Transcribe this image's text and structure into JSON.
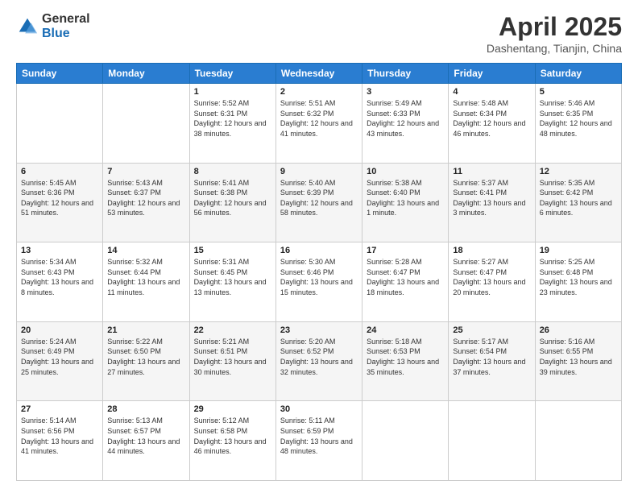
{
  "logo": {
    "general": "General",
    "blue": "Blue"
  },
  "title": "April 2025",
  "subtitle": "Dashentang, Tianjin, China",
  "days_of_week": [
    "Sunday",
    "Monday",
    "Tuesday",
    "Wednesday",
    "Thursday",
    "Friday",
    "Saturday"
  ],
  "weeks": [
    [
      {
        "day": "",
        "info": ""
      },
      {
        "day": "",
        "info": ""
      },
      {
        "day": "1",
        "info": "Sunrise: 5:52 AM\nSunset: 6:31 PM\nDaylight: 12 hours and 38 minutes."
      },
      {
        "day": "2",
        "info": "Sunrise: 5:51 AM\nSunset: 6:32 PM\nDaylight: 12 hours and 41 minutes."
      },
      {
        "day": "3",
        "info": "Sunrise: 5:49 AM\nSunset: 6:33 PM\nDaylight: 12 hours and 43 minutes."
      },
      {
        "day": "4",
        "info": "Sunrise: 5:48 AM\nSunset: 6:34 PM\nDaylight: 12 hours and 46 minutes."
      },
      {
        "day": "5",
        "info": "Sunrise: 5:46 AM\nSunset: 6:35 PM\nDaylight: 12 hours and 48 minutes."
      }
    ],
    [
      {
        "day": "6",
        "info": "Sunrise: 5:45 AM\nSunset: 6:36 PM\nDaylight: 12 hours and 51 minutes."
      },
      {
        "day": "7",
        "info": "Sunrise: 5:43 AM\nSunset: 6:37 PM\nDaylight: 12 hours and 53 minutes."
      },
      {
        "day": "8",
        "info": "Sunrise: 5:41 AM\nSunset: 6:38 PM\nDaylight: 12 hours and 56 minutes."
      },
      {
        "day": "9",
        "info": "Sunrise: 5:40 AM\nSunset: 6:39 PM\nDaylight: 12 hours and 58 minutes."
      },
      {
        "day": "10",
        "info": "Sunrise: 5:38 AM\nSunset: 6:40 PM\nDaylight: 13 hours and 1 minute."
      },
      {
        "day": "11",
        "info": "Sunrise: 5:37 AM\nSunset: 6:41 PM\nDaylight: 13 hours and 3 minutes."
      },
      {
        "day": "12",
        "info": "Sunrise: 5:35 AM\nSunset: 6:42 PM\nDaylight: 13 hours and 6 minutes."
      }
    ],
    [
      {
        "day": "13",
        "info": "Sunrise: 5:34 AM\nSunset: 6:43 PM\nDaylight: 13 hours and 8 minutes."
      },
      {
        "day": "14",
        "info": "Sunrise: 5:32 AM\nSunset: 6:44 PM\nDaylight: 13 hours and 11 minutes."
      },
      {
        "day": "15",
        "info": "Sunrise: 5:31 AM\nSunset: 6:45 PM\nDaylight: 13 hours and 13 minutes."
      },
      {
        "day": "16",
        "info": "Sunrise: 5:30 AM\nSunset: 6:46 PM\nDaylight: 13 hours and 15 minutes."
      },
      {
        "day": "17",
        "info": "Sunrise: 5:28 AM\nSunset: 6:47 PM\nDaylight: 13 hours and 18 minutes."
      },
      {
        "day": "18",
        "info": "Sunrise: 5:27 AM\nSunset: 6:47 PM\nDaylight: 13 hours and 20 minutes."
      },
      {
        "day": "19",
        "info": "Sunrise: 5:25 AM\nSunset: 6:48 PM\nDaylight: 13 hours and 23 minutes."
      }
    ],
    [
      {
        "day": "20",
        "info": "Sunrise: 5:24 AM\nSunset: 6:49 PM\nDaylight: 13 hours and 25 minutes."
      },
      {
        "day": "21",
        "info": "Sunrise: 5:22 AM\nSunset: 6:50 PM\nDaylight: 13 hours and 27 minutes."
      },
      {
        "day": "22",
        "info": "Sunrise: 5:21 AM\nSunset: 6:51 PM\nDaylight: 13 hours and 30 minutes."
      },
      {
        "day": "23",
        "info": "Sunrise: 5:20 AM\nSunset: 6:52 PM\nDaylight: 13 hours and 32 minutes."
      },
      {
        "day": "24",
        "info": "Sunrise: 5:18 AM\nSunset: 6:53 PM\nDaylight: 13 hours and 35 minutes."
      },
      {
        "day": "25",
        "info": "Sunrise: 5:17 AM\nSunset: 6:54 PM\nDaylight: 13 hours and 37 minutes."
      },
      {
        "day": "26",
        "info": "Sunrise: 5:16 AM\nSunset: 6:55 PM\nDaylight: 13 hours and 39 minutes."
      }
    ],
    [
      {
        "day": "27",
        "info": "Sunrise: 5:14 AM\nSunset: 6:56 PM\nDaylight: 13 hours and 41 minutes."
      },
      {
        "day": "28",
        "info": "Sunrise: 5:13 AM\nSunset: 6:57 PM\nDaylight: 13 hours and 44 minutes."
      },
      {
        "day": "29",
        "info": "Sunrise: 5:12 AM\nSunset: 6:58 PM\nDaylight: 13 hours and 46 minutes."
      },
      {
        "day": "30",
        "info": "Sunrise: 5:11 AM\nSunset: 6:59 PM\nDaylight: 13 hours and 48 minutes."
      },
      {
        "day": "",
        "info": ""
      },
      {
        "day": "",
        "info": ""
      },
      {
        "day": "",
        "info": ""
      }
    ]
  ]
}
